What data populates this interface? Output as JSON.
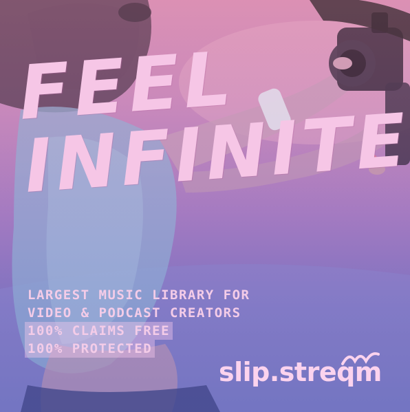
{
  "headline": {
    "line1": "FEEL",
    "line2": "INFINITE"
  },
  "subcopy": {
    "line1": "LARGEST MUSIC LIBRARY FOR",
    "line2": "VIDEO & PODCAST CREATORS",
    "highlight1": "100% CLAIMS FREE",
    "highlight2": "100% PROTECTED"
  },
  "brand": {
    "logo_text": "slip.streqm"
  },
  "colors": {
    "headline": "#f6c6e6",
    "subcopy": "#f4cce8",
    "highlight_bg": "#f6c8eb",
    "bg_top": "#d892b4",
    "bg_bottom": "#6a6cb8"
  }
}
